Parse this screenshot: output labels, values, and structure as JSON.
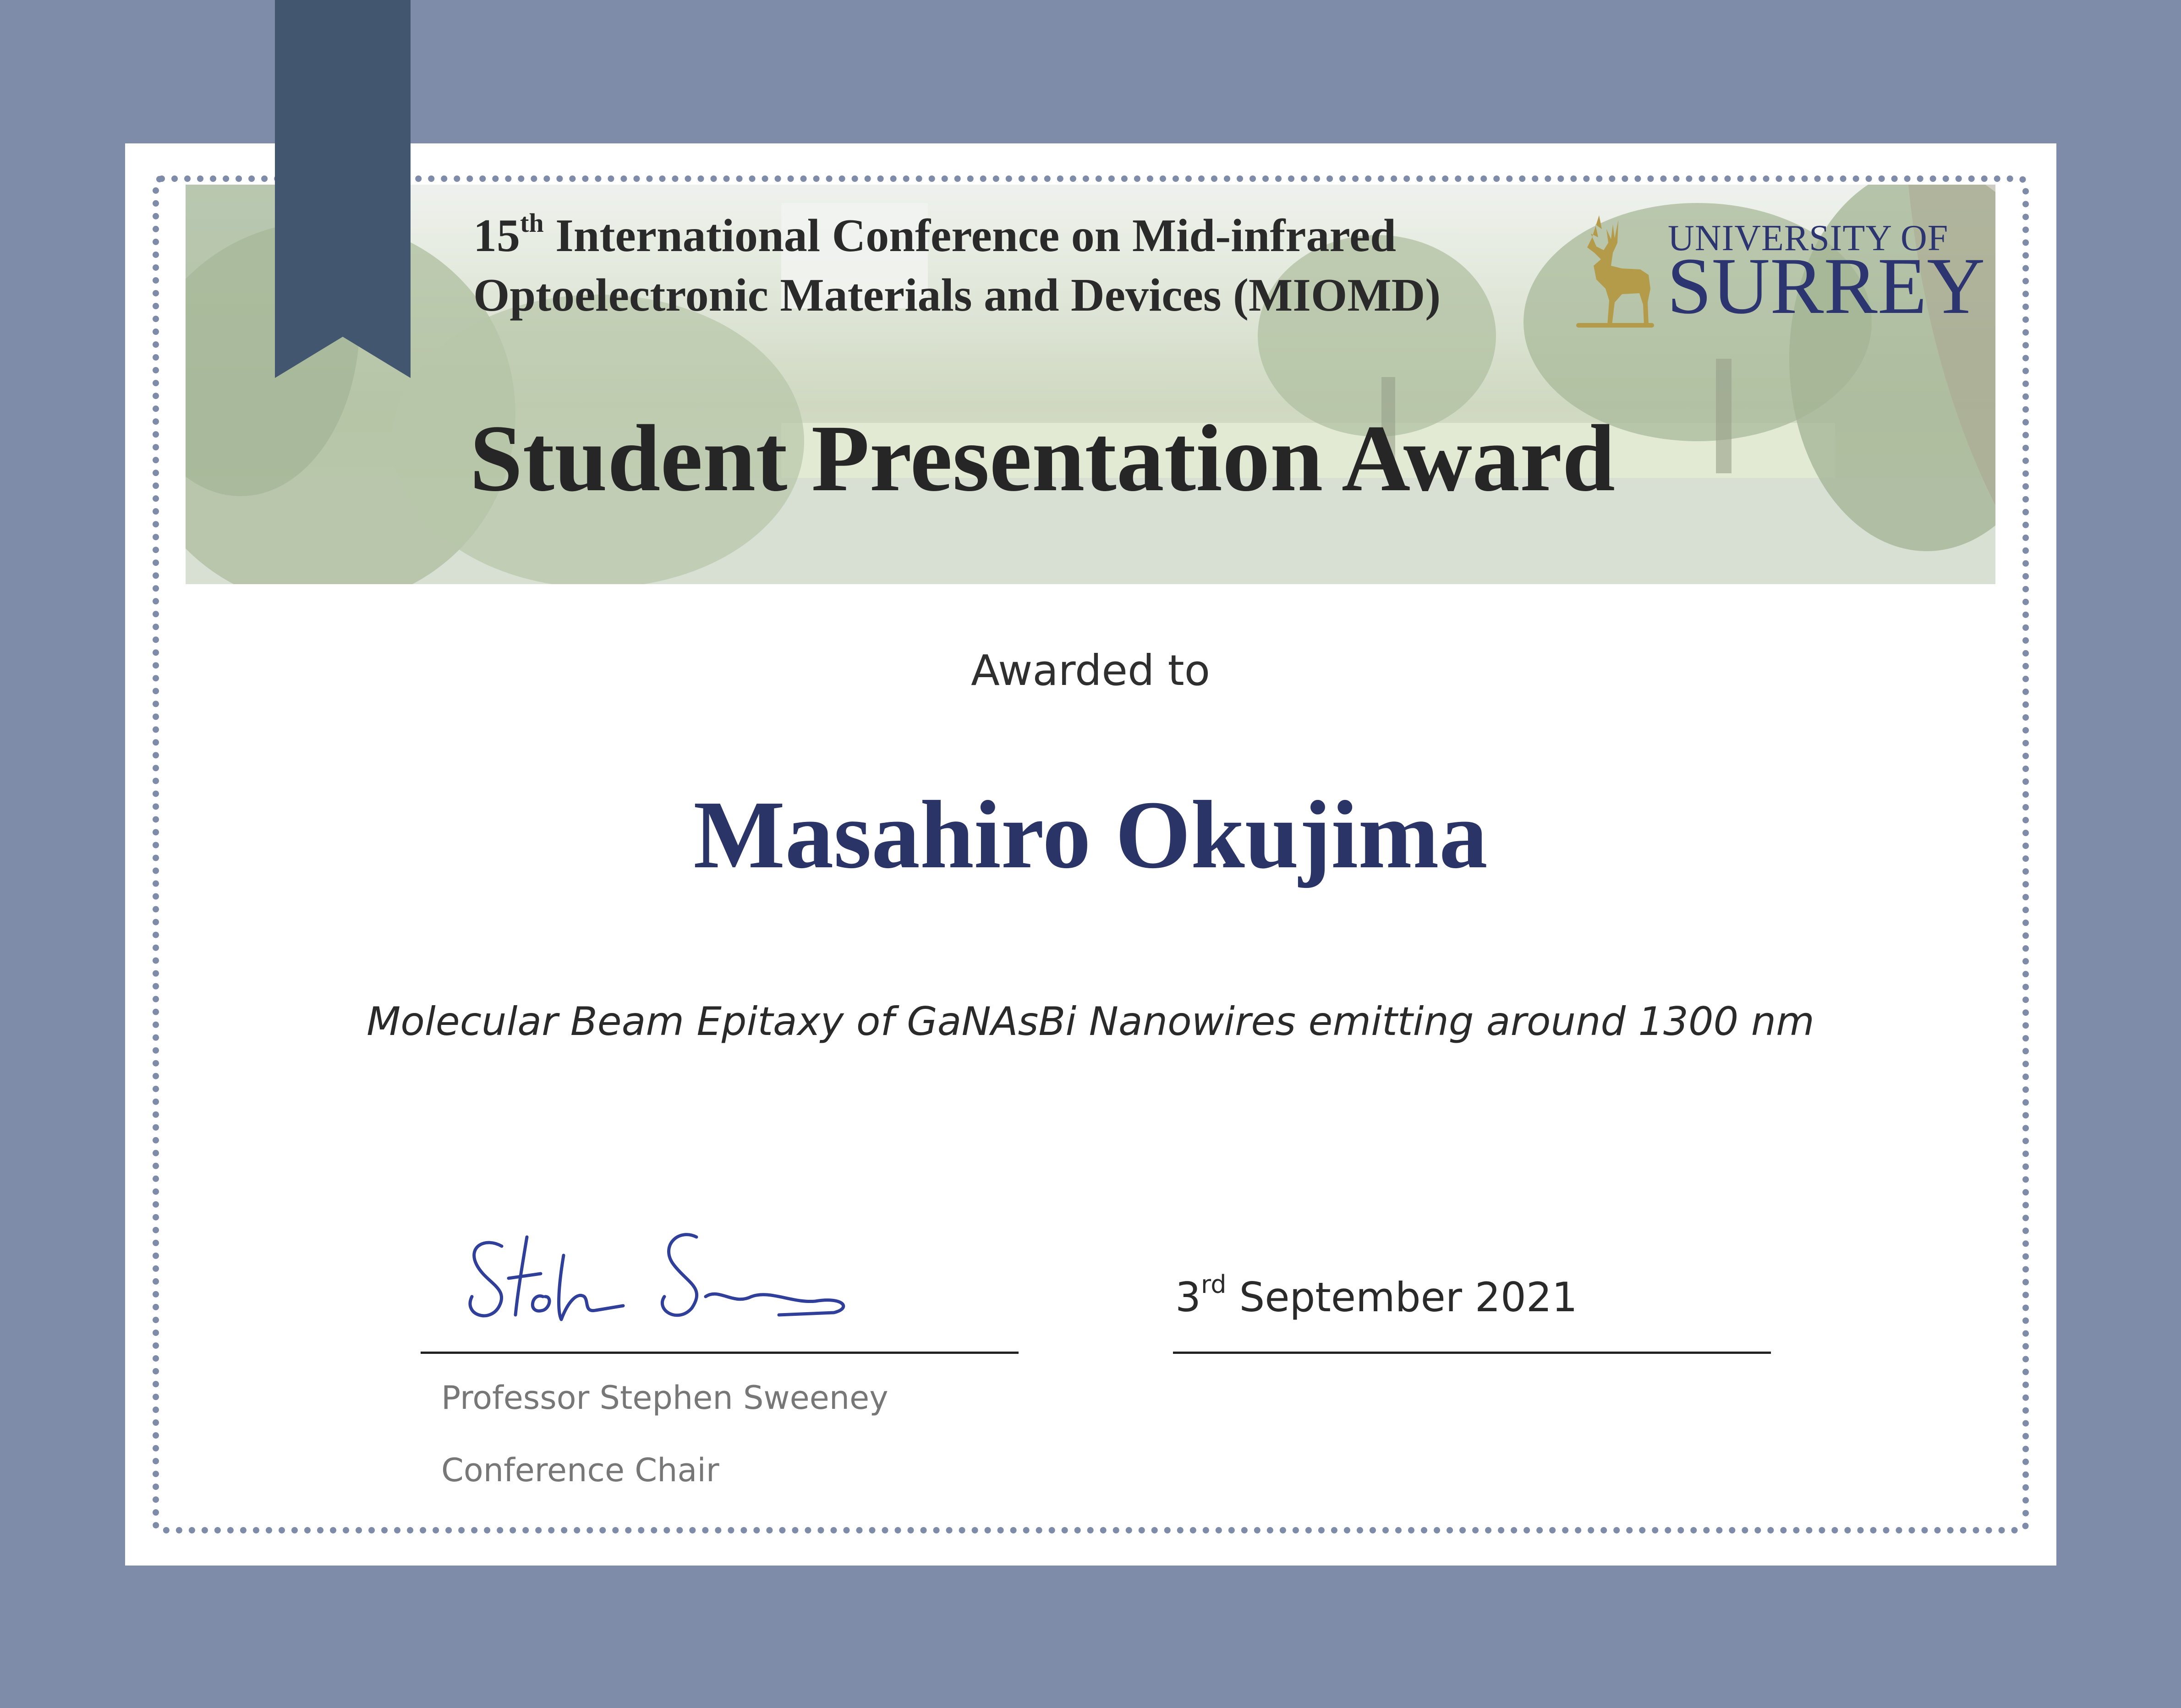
{
  "certificate": {
    "conference": {
      "ordinal_number": "15",
      "ordinal_suffix": "th",
      "line1_rest": " International Conference on Mid-infrared",
      "line2": "Optoelectronic Materials and Devices (MIOMD)"
    },
    "university": {
      "line1": "UNIVERSITY OF",
      "line2": "SURREY",
      "logo_icon": "stag-icon"
    },
    "award_title": "Student Presentation Award",
    "awarded_to_label": "Awarded to",
    "recipient_name": "Masahiro Okujima",
    "project_title": "Molecular Beam Epitaxy of GaNAsBi Nanowires emitting around 1300 nm",
    "date": {
      "day": "3",
      "day_suffix": "rd",
      "rest": " September 2021"
    },
    "signer": {
      "name": "Professor Stephen Sweeney",
      "role": "Conference Chair",
      "signature_icon": "handwritten-signature"
    }
  },
  "colors": {
    "background": "#7f8ca9",
    "ribbon": "#43566f",
    "name_navy": "#2b3467",
    "university_navy": "#2c3570",
    "stag_gold": "#b39b4a"
  }
}
